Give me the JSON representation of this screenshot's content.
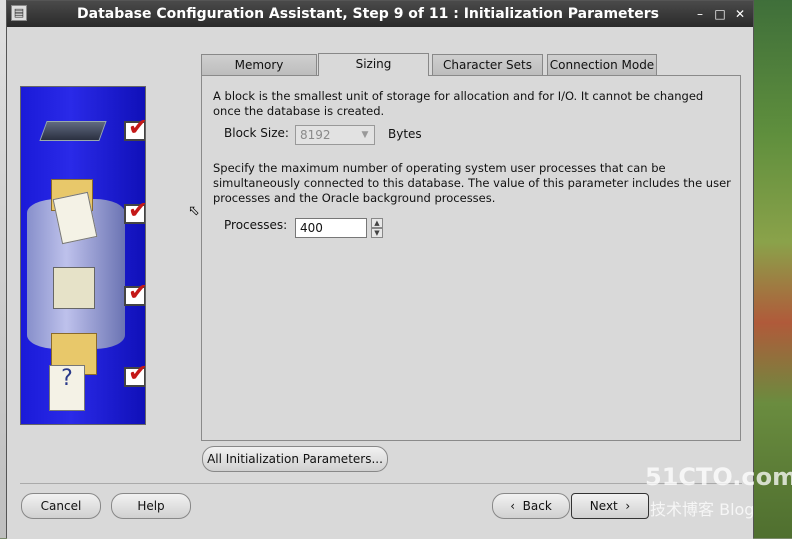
{
  "window": {
    "title": "Database Configuration Assistant, Step 9 of 11 : Initialization Parameters"
  },
  "tabs": [
    {
      "label": "Memory"
    },
    {
      "label": "Sizing"
    },
    {
      "label": "Character Sets"
    },
    {
      "label": "Connection Mode"
    }
  ],
  "active_tab": "Sizing",
  "sizing": {
    "block_description": "A block is the smallest unit of storage for allocation and for I/O. It cannot be changed once the database is created.",
    "block_size_label": "Block Size:",
    "block_size_value": "8192",
    "block_size_unit": "Bytes",
    "processes_description": "Specify the maximum number of operating system user processes that can be simultaneously connected to this database. The value of this parameter includes the user processes and the Oracle background processes.",
    "processes_label": "Processes:",
    "processes_value": "400"
  },
  "buttons": {
    "all_params": "All Initialization Parameters...",
    "cancel": "Cancel",
    "help": "Help",
    "back": "Back",
    "next": "Next"
  },
  "watermark": {
    "main": "51CTO.com",
    "sub": "技术博客 Blog"
  }
}
